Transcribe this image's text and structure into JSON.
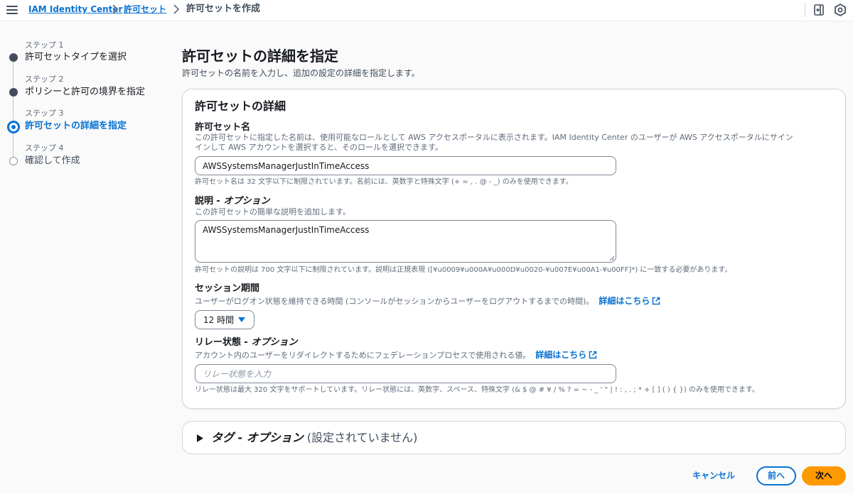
{
  "breadcrumbs": [
    {
      "label": "IAM Identity Center"
    },
    {
      "label": "許可セット"
    },
    {
      "label": "許可セットを作成"
    }
  ],
  "steps": [
    {
      "number": "ステップ 1",
      "title": "許可セットタイプを選択",
      "state": "completed"
    },
    {
      "number": "ステップ 2",
      "title": "ポリシーと許可の境界を指定",
      "state": "completed"
    },
    {
      "number": "ステップ 3",
      "title": "許可セットの詳細を指定",
      "state": "active"
    },
    {
      "number": "ステップ 4",
      "title": "確認して作成",
      "state": "upcoming"
    }
  ],
  "page": {
    "title": "許可セットの詳細を指定",
    "description": "許可セットの名前を入力し、追加の設定の詳細を指定します。"
  },
  "details": {
    "title": "許可セットの詳細",
    "name": {
      "label": "許可セット名",
      "description": "この許可セットに指定した名前は、使用可能なロールとして AWS アクセスポータルに表示されます。IAM Identity Center のユーザーが AWS アクセスポータルにサインインして AWS アカウントを選択すると、そのロールを選択できます。",
      "value": "AWSSystemsManagerJustInTimeAccess",
      "hint": "許可セット名は 32 文字以下に制限されています。名前には、英数字と特殊文字 (+ = , . @ - _) のみを使用できます。"
    },
    "description_field": {
      "label": "説明",
      "optional": " - オプション",
      "description": "この許可セットの簡単な説明を追加します。",
      "value": "AWSSystemsManagerJustInTimeAccess",
      "hint": "許可セットの説明は 700 文字以下に制限されています。説明は正規表現 ([¥u0009¥u000A¥u000D¥u0020-¥u007E¥u00A1-¥u00FF]*) に一致する必要があります。"
    },
    "session": {
      "label": "セッション期間",
      "description": "ユーザーがログオン状態を維持できる時間 (コンソールがセッションからユーザーをログアウトするまでの時間)。",
      "link": "詳細はこちら",
      "value": "12 時間"
    },
    "relay": {
      "label": "リレー状態",
      "optional": " - オプション",
      "description": "アカウント内のユーザーをリダイレクトするためにフェデレーションプロセスで使用される値。",
      "link": "詳細はこちら",
      "placeholder": "リレー状態を入力",
      "hint": "リレー状態は最大 320 文字をサポートしています。リレー状態には、英数字、スペース、特殊文字 (& $ @ # ¥ / % ? = ~ - _ ' \" | ! : , . ; * + [ ] ( ) { }) のみを使用できます。"
    }
  },
  "tags": {
    "title": "タグ - オプション",
    "status": "(設定されていません)"
  },
  "actions": {
    "cancel": "キャンセル",
    "previous": "前へ",
    "next": "次へ"
  },
  "colors": {
    "link": "#0972d3",
    "primary_button": "#ff9900",
    "step_completed": "#414d5c"
  }
}
